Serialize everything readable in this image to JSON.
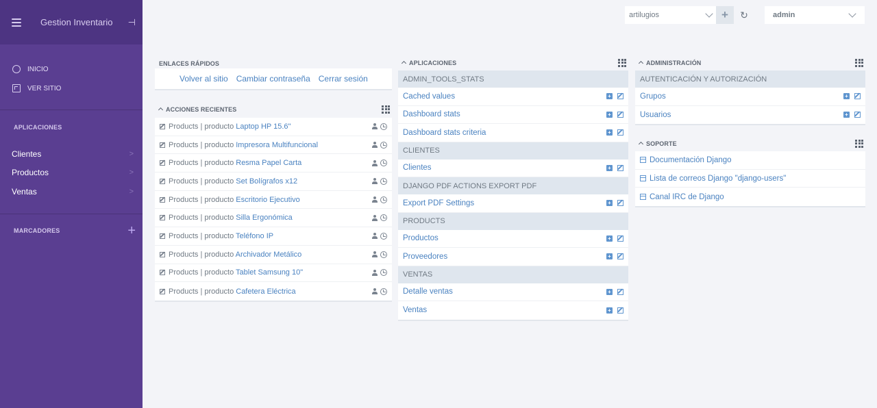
{
  "sidebar": {
    "title": "Gestion Inventario",
    "links": [
      {
        "label": "INICIO"
      },
      {
        "label": "VER SITIO"
      }
    ],
    "apps_title": "APLICACIONES",
    "apps": [
      {
        "label": "Clientes"
      },
      {
        "label": "Productos"
      },
      {
        "label": "Ventas"
      }
    ],
    "bookmarks_title": "MARCADORES",
    "bg_color": "#5a3e91",
    "header_color": "#4d3482"
  },
  "topbar": {
    "theme_select": "artilugios",
    "add_symbol": "+",
    "refresh_symbol": "↻",
    "user_select": "admin"
  },
  "quick_links": {
    "title": "ENLACES RÁPIDOS",
    "links": [
      "Volver al sitio",
      "Cambiar contraseña",
      "Cerrar sesión"
    ]
  },
  "recent_actions": {
    "title": "ACCIONES RECIENTES",
    "items": [
      {
        "prefix": "Products | producto",
        "object": "Laptop HP 15.6\""
      },
      {
        "prefix": "Products | producto",
        "object": "Impresora Multifuncional"
      },
      {
        "prefix": "Products | producto",
        "object": "Resma Papel Carta"
      },
      {
        "prefix": "Products | producto",
        "object": "Set Bolígrafos x12"
      },
      {
        "prefix": "Products | producto",
        "object": "Escritorio Ejecutivo"
      },
      {
        "prefix": "Products | producto",
        "object": "Silla Ergonómica"
      },
      {
        "prefix": "Products | producto",
        "object": "Teléfono IP"
      },
      {
        "prefix": "Products | producto",
        "object": "Archivador Metálico"
      },
      {
        "prefix": "Products | producto",
        "object": "Tablet Samsung 10\""
      },
      {
        "prefix": "Products | producto",
        "object": "Cafetera Eléctrica"
      }
    ]
  },
  "applications": {
    "title": "APLICACIONES",
    "groups": [
      {
        "name": "ADMIN_TOOLS_STATS",
        "models": [
          "Cached values",
          "Dashboard stats",
          "Dashboard stats criteria"
        ]
      },
      {
        "name": "CLIENTES",
        "models": [
          "Clientes"
        ]
      },
      {
        "name": "DJANGO PDF ACTIONS EXPORT PDF",
        "models": [
          "Export PDF Settings"
        ]
      },
      {
        "name": "PRODUCTS",
        "models": [
          "Productos",
          "Proveedores"
        ]
      },
      {
        "name": "VENTAS",
        "models": [
          "Detalle ventas",
          "Ventas"
        ]
      }
    ]
  },
  "administration": {
    "title": "ADMINISTRACIÓN",
    "group": "AUTENTICACIÓN Y AUTORIZACIÓN",
    "models": [
      "Grupos",
      "Usuarios"
    ]
  },
  "support": {
    "title": "SOPORTE",
    "links": [
      "Documentación Django",
      "Lista de correos Django \"django-users\"",
      "Canal IRC de Django"
    ]
  }
}
